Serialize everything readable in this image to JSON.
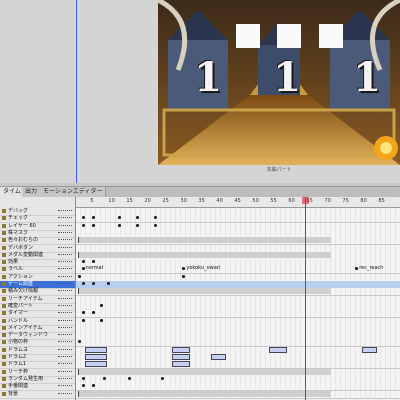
{
  "stage": {
    "label": "本編パート",
    "reel_digits": [
      "1",
      "1",
      "1"
    ],
    "colors": {
      "hall_gold": "#c79a3a",
      "frame_bg": "#2a1a0c"
    }
  },
  "tabs": [
    {
      "label": "タイムライン"
    },
    {
      "label": "出力"
    },
    {
      "label": "モーションエディター"
    }
  ],
  "ruler": {
    "ticks": [
      "5",
      "10",
      "15",
      "20",
      "25",
      "30",
      "35",
      "40",
      "45",
      "50",
      "55",
      "60",
      "65",
      "70",
      "75",
      "80",
      "85"
    ],
    "current_frame": 64
  },
  "layers": [
    {
      "name": "デバッグ",
      "frames": []
    },
    {
      "name": "チェック",
      "frames": []
    },
    {
      "name": "レイヤー 60",
      "frames": []
    },
    {
      "name": "株マスク",
      "frames": []
    },
    {
      "name": "色々おむらの",
      "frames": []
    },
    {
      "name": "デバボタン",
      "frames": []
    },
    {
      "name": "メダル変動関連",
      "frames": []
    },
    {
      "name": "効果",
      "frames": []
    },
    {
      "name": "ラベル",
      "labels": [
        "normal",
        "yokoku_owari",
        "rec_reach"
      ]
    },
    {
      "name": "アクション",
      "frames": []
    },
    {
      "name": "ゲーム関連",
      "selected": true,
      "frames": []
    },
    {
      "name": "積み欠け情報",
      "frames": []
    },
    {
      "name": "リーチアイテム",
      "frames": []
    },
    {
      "name": "確変パート",
      "frames": []
    },
    {
      "name": "タイマー",
      "frames": []
    },
    {
      "name": "ハンドル",
      "frames": []
    },
    {
      "name": "メインアイテム",
      "frames": []
    },
    {
      "name": "データウィンドウ",
      "frames": []
    },
    {
      "name": "小物の枠",
      "frames": []
    },
    {
      "name": "ドラムヨ",
      "frames": []
    },
    {
      "name": "ドラム2",
      "frames": []
    },
    {
      "name": "ドラム1",
      "frames": []
    },
    {
      "name": "リーチ枠",
      "frames": []
    },
    {
      "name": "ランダム発生用",
      "frames": []
    },
    {
      "name": "手番関連",
      "frames": []
    },
    {
      "name": "背景",
      "frames": []
    }
  ],
  "colors": {
    "playhead": "#e0202a",
    "selected_layer": "#3b6fd6",
    "guide": "#3a5cff"
  }
}
